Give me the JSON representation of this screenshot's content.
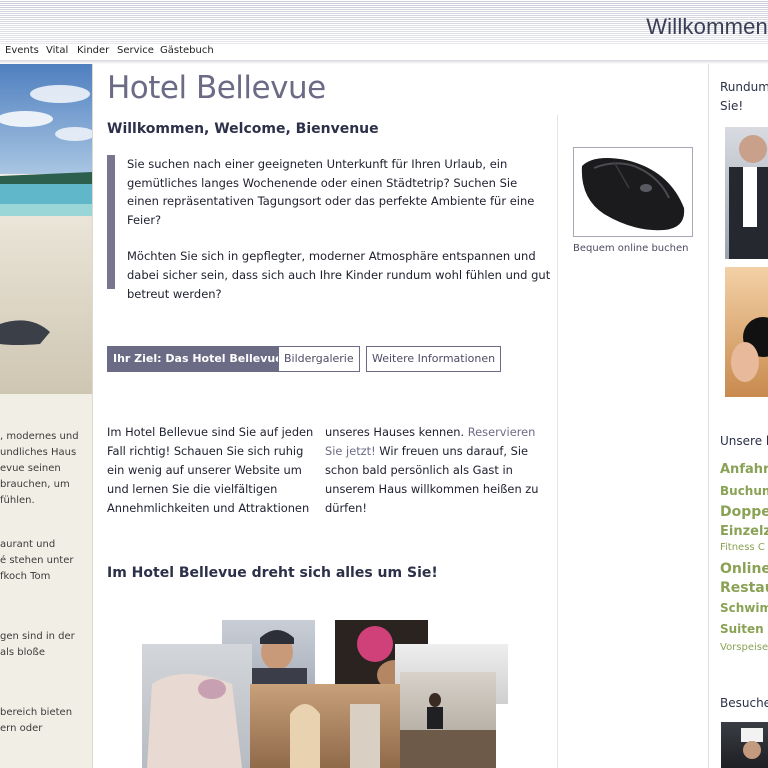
{
  "header": {
    "welcome_text": "Willkommen"
  },
  "nav": {
    "items": [
      "Events",
      "Vital",
      "Kinder",
      "Service",
      "Gästebuch"
    ]
  },
  "left_sidebar": {
    "text_lines_1": [
      ", modernes und",
      "undliches Haus",
      "evue seinen",
      " brauchen, um",
      "fühlen."
    ],
    "text_lines_2": [
      "aurant und",
      "é stehen unter",
      "fkoch Tom"
    ],
    "text_lines_3": [
      "gen sind in der",
      "als bloße"
    ],
    "text_lines_4": [
      "bereich bieten",
      "ern oder"
    ]
  },
  "main": {
    "title": "Hotel Bellevue",
    "subtitle": "Willkommen, Welcome, Bienvenue",
    "quote_p1": "Sie suchen nach einer geeigneten Unterkunft für Ihren Urlaub, ein gemütliches langes Wochenende oder einen Städtetrip? Suchen Sie einen repräsentativen Tagungsort oder das perfekte Ambiente für eine Feier?",
    "quote_p2": "Möchten Sie sich in gepflegter, moderner Atmosphäre entspannen und dabei sicher sein, dass sich auch Ihre Kinder rundum wohl fühlen und gut betreut werden?",
    "tabs": [
      "Ihr Ziel: Das Hotel Bellevue",
      "Bildergalerie",
      "Weitere Informationen"
    ],
    "col1_lines": [
      "Im Hotel Bellevue sind Sie auf jeden",
      "Fall richtig! Schauen Sie sich ruhig",
      "ein wenig auf unserer Website um",
      "und lernen Sie die vielfältigen",
      "Annehmlichkeiten und Attraktionen"
    ],
    "col2_line1": "unseres Hauses kennen.",
    "col2_link_a": "Reservieren",
    "col2_link_b": "Sie jetzt!",
    "col2_line2_rest": " Wir freuen uns darauf, Sie",
    "col2_lines_rest": [
      "schon bald persönlich als Gast in",
      "unserem Haus willkommen heißen zu",
      "dürfen!"
    ],
    "section_heading": "Im Hotel Bellevue dreht sich alles um Sie!"
  },
  "sidebar_ad": {
    "caption": "Bequem online buchen"
  },
  "right_col": {
    "heading_1": [
      "Rundum",
      "Sie!"
    ],
    "heading_2": "Unsere l",
    "tags": [
      {
        "label": "Anfahrt",
        "size": 13
      },
      {
        "label": "Buchung",
        "size": 12
      },
      {
        "label": "Doppel",
        "size": 14
      },
      {
        "label": "Einzelzi",
        "size": 13
      },
      {
        "label": "Fitness C",
        "size": 10
      },
      {
        "label": "Online-",
        "size": 14
      },
      {
        "label": "Restau",
        "size": 14
      },
      {
        "label": "Schwimm",
        "size": 12
      },
      {
        "label": "Suiten T",
        "size": 12
      },
      {
        "label": "Vorspeise",
        "size": 10
      }
    ],
    "heading_3": "Besuche"
  },
  "colors": {
    "accent": "#6c6b86",
    "tag_green": "#8aa255",
    "heading": "#2c3048"
  }
}
